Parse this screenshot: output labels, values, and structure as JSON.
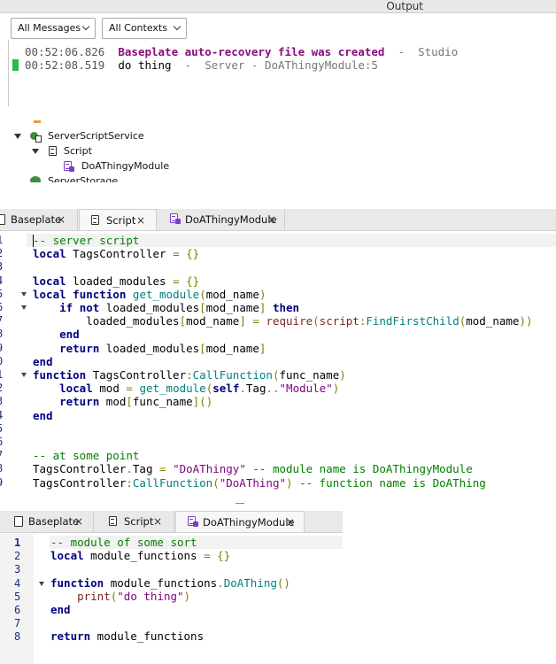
{
  "output": {
    "title": "Output",
    "filter_messages": "All Messages",
    "filter_contexts": "All Contexts",
    "logs": [
      {
        "time": "00:52:06.826",
        "message": "Baseplate auto-recovery file was created",
        "sep": "-",
        "source": "Studio"
      },
      {
        "time": "00:52:08.519",
        "message": "do thing",
        "sep": "-",
        "source": "Server - DoAThingyModule:5"
      }
    ]
  },
  "explorer": {
    "items": [
      {
        "label": "ServerScriptService"
      },
      {
        "label": "Script"
      },
      {
        "label": "DoAThingyModule"
      },
      {
        "label": "ServerStorage"
      }
    ]
  },
  "editor1": {
    "tabs": [
      {
        "label": "Baseplate",
        "close": "×"
      },
      {
        "label": "Script",
        "close": "×"
      },
      {
        "label": "DoAThingyModule",
        "close": "×"
      }
    ],
    "line_numbers": [
      "1",
      "2",
      "3",
      "4",
      "5",
      "6",
      "7",
      "8",
      "9",
      "0",
      "1",
      "2",
      "3",
      "4",
      "5",
      "6",
      "7",
      "8",
      "9"
    ],
    "lines": [
      [
        [
          "cm",
          "-- server script"
        ]
      ],
      [
        [
          "kw",
          "local"
        ],
        [
          "id",
          " TagsController "
        ],
        [
          "op",
          "="
        ],
        [
          "id",
          " "
        ],
        [
          "op",
          "{}"
        ]
      ],
      [],
      [
        [
          "kw",
          "local"
        ],
        [
          "id",
          " loaded_modules "
        ],
        [
          "op",
          "="
        ],
        [
          "id",
          " "
        ],
        [
          "op",
          "{}"
        ]
      ],
      [
        [
          "kw",
          "local"
        ],
        [
          "id",
          " "
        ],
        [
          "kw",
          "function"
        ],
        [
          "id",
          " "
        ],
        [
          "fn",
          "get_module"
        ],
        [
          "op",
          "("
        ],
        [
          "id",
          "mod_name"
        ],
        [
          "op",
          ")"
        ]
      ],
      [
        [
          "id",
          "    "
        ],
        [
          "kw",
          "if"
        ],
        [
          "id",
          " "
        ],
        [
          "kw",
          "not"
        ],
        [
          "id",
          " loaded_modules"
        ],
        [
          "op",
          "["
        ],
        [
          "id",
          "mod_name"
        ],
        [
          "op",
          "]"
        ],
        [
          "id",
          " "
        ],
        [
          "kw",
          "then"
        ]
      ],
      [
        [
          "id",
          "        loaded_modules"
        ],
        [
          "op",
          "["
        ],
        [
          "id",
          "mod_name"
        ],
        [
          "op",
          "]"
        ],
        [
          "id",
          " "
        ],
        [
          "op",
          "="
        ],
        [
          "id",
          " "
        ],
        [
          "bi",
          "require"
        ],
        [
          "op",
          "("
        ],
        [
          "bi",
          "script"
        ],
        [
          "op",
          ":"
        ],
        [
          "fn",
          "FindFirstChild"
        ],
        [
          "op",
          "("
        ],
        [
          "id",
          "mod_name"
        ],
        [
          "op",
          "))"
        ]
      ],
      [
        [
          "id",
          "    "
        ],
        [
          "kw",
          "end"
        ]
      ],
      [
        [
          "id",
          "    "
        ],
        [
          "kw",
          "return"
        ],
        [
          "id",
          " loaded_modules"
        ],
        [
          "op",
          "["
        ],
        [
          "id",
          "mod_name"
        ],
        [
          "op",
          "]"
        ]
      ],
      [
        [
          "kw",
          "end"
        ]
      ],
      [
        [
          "kw",
          "function"
        ],
        [
          "id",
          " TagsController"
        ],
        [
          "op",
          ":"
        ],
        [
          "fn",
          "CallFunction"
        ],
        [
          "op",
          "("
        ],
        [
          "id",
          "func_name"
        ],
        [
          "op",
          ")"
        ]
      ],
      [
        [
          "id",
          "    "
        ],
        [
          "kw",
          "local"
        ],
        [
          "id",
          " mod "
        ],
        [
          "op",
          "="
        ],
        [
          "id",
          " "
        ],
        [
          "fn",
          "get_module"
        ],
        [
          "op",
          "("
        ],
        [
          "kw",
          "self"
        ],
        [
          "op",
          "."
        ],
        [
          "id",
          "Tag"
        ],
        [
          "op",
          ".."
        ],
        [
          "st",
          "\"Module\""
        ],
        [
          "op",
          ")"
        ]
      ],
      [
        [
          "id",
          "    "
        ],
        [
          "kw",
          "return"
        ],
        [
          "id",
          " mod"
        ],
        [
          "op",
          "["
        ],
        [
          "id",
          "func_name"
        ],
        [
          "op",
          "]()"
        ]
      ],
      [
        [
          "kw",
          "end"
        ]
      ],
      [],
      [],
      [
        [
          "cm",
          "-- at some point"
        ]
      ],
      [
        [
          "id",
          "TagsController"
        ],
        [
          "op",
          "."
        ],
        [
          "id",
          "Tag "
        ],
        [
          "op",
          "="
        ],
        [
          "id",
          " "
        ],
        [
          "st",
          "\"DoAThingy\""
        ],
        [
          "id",
          " "
        ],
        [
          "cm",
          "-- module name is DoAThingyModule"
        ]
      ],
      [
        [
          "id",
          "TagsController"
        ],
        [
          "op",
          ":"
        ],
        [
          "fn",
          "CallFunction"
        ],
        [
          "op",
          "("
        ],
        [
          "st",
          "\"DoAThing\""
        ],
        [
          "op",
          ")"
        ],
        [
          "id",
          " "
        ],
        [
          "cm",
          "-- function name is DoAThing"
        ]
      ]
    ]
  },
  "editor2": {
    "tabs": [
      {
        "label": "Baseplate",
        "close": "×"
      },
      {
        "label": "Script",
        "close": "×"
      },
      {
        "label": "DoAThingyModule",
        "close": "×"
      }
    ],
    "line_numbers": [
      "1",
      "2",
      "3",
      "4",
      "5",
      "6",
      "7",
      "8"
    ],
    "lines": [
      [
        [
          "cm",
          "-- module of some sort"
        ]
      ],
      [
        [
          "kw",
          "local"
        ],
        [
          "id",
          " module_functions "
        ],
        [
          "op",
          "="
        ],
        [
          "id",
          " "
        ],
        [
          "op",
          "{}"
        ]
      ],
      [],
      [
        [
          "kw",
          "function"
        ],
        [
          "id",
          " module_functions"
        ],
        [
          "op",
          "."
        ],
        [
          "fn",
          "DoAThing"
        ],
        [
          "op",
          "()"
        ]
      ],
      [
        [
          "id",
          "    "
        ],
        [
          "bi",
          "print"
        ],
        [
          "op",
          "("
        ],
        [
          "st",
          "\"do thing\""
        ],
        [
          "op",
          ")"
        ]
      ],
      [
        [
          "kw",
          "end"
        ]
      ],
      [],
      [
        [
          "kw",
          "return"
        ],
        [
          "id",
          " module_functions"
        ]
      ]
    ]
  },
  "colors": {
    "keyword": "#00007f",
    "comment": "#007f00",
    "string": "#7f007f",
    "function": "#007f7f",
    "builtin": "#7f1f1f",
    "operator": "#7f7f00",
    "log_highlight": "#8a0c7e",
    "server_marker": "#2bb94a"
  }
}
